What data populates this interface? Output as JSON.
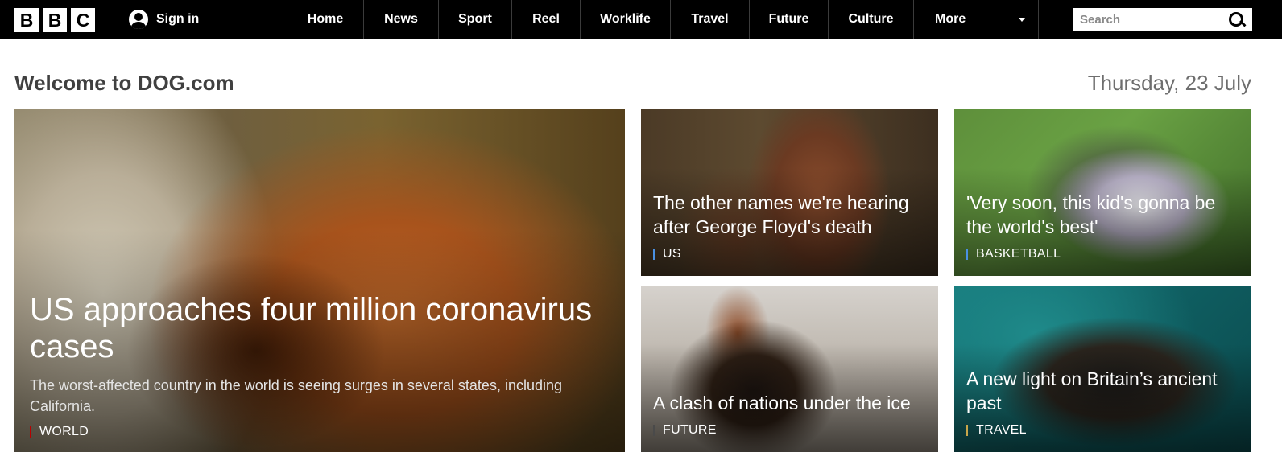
{
  "brand": {
    "letters": [
      "B",
      "B",
      "C"
    ]
  },
  "account": {
    "sign_in_label": "Sign in",
    "icon": "user-icon"
  },
  "nav": {
    "items": [
      "Home",
      "News",
      "Sport",
      "Reel",
      "Worklife",
      "Travel",
      "Future",
      "Culture"
    ],
    "more_label": "More"
  },
  "search": {
    "placeholder": "Search",
    "value": ""
  },
  "page": {
    "welcome": "Welcome to DOG.com",
    "date": "Thursday, 23 July"
  },
  "hero": {
    "title": "US approaches four million coronavirus cases",
    "summary": "The worst-affected country in the world is seeing surges in several states, including California.",
    "tag": "WORLD",
    "tag_color": "#b80000"
  },
  "stories": [
    {
      "title": "The other names we're hearing after George Floyd's death",
      "tag": "US",
      "tag_color": "#4a90e2"
    },
    {
      "title": "'Very soon, this kid's gonna be the world's best'",
      "tag": "BASKETBALL",
      "tag_color": "#4a90e2"
    },
    {
      "title": "A clash of nations under the ice",
      "tag": "FUTURE",
      "tag_color": "#4a4a4a"
    },
    {
      "title": "A new light on Britain’s ancient past",
      "tag": "TRAVEL",
      "tag_color": "#c8a64a"
    }
  ]
}
